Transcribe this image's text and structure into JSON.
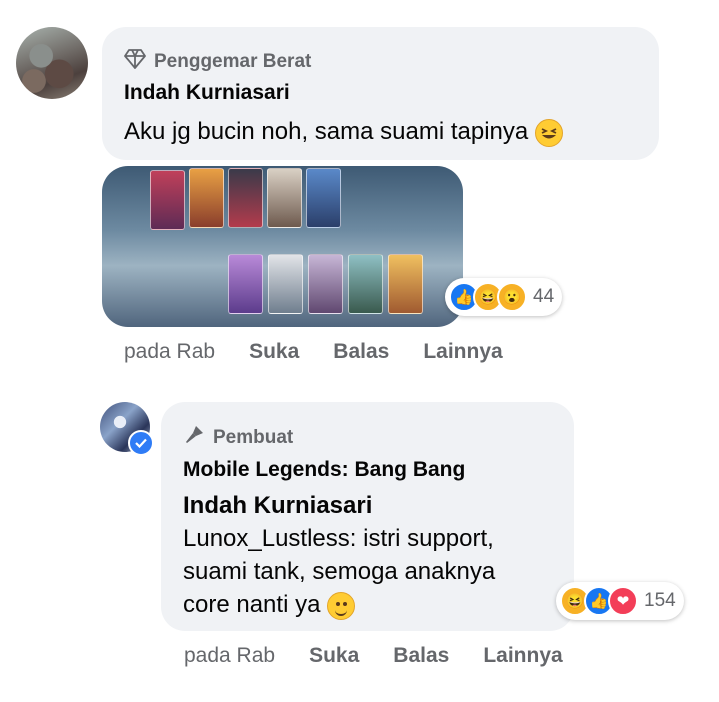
{
  "comments": [
    {
      "badge": "Penggemar Berat",
      "badge_icon": "diamond-icon",
      "author": "Indah Kurniasari",
      "text": "Aku jg bucin noh, sama suami tapinya",
      "emoji": "grinning-squinting-face",
      "attachment": "game-screenshot",
      "reactions": {
        "types": [
          "like",
          "haha",
          "wow"
        ],
        "count": "44"
      },
      "time": "pada Rab",
      "actions": [
        "Suka",
        "Balas",
        "Lainnya"
      ]
    },
    {
      "badge": "Pembuat",
      "badge_icon": "microphone-icon",
      "page": "Mobile Legends: Bang Bang",
      "author": "Indah Kurniasari",
      "text_lines": [
        "Lunox_Lustless: istri support,",
        "suami tank, semoga anaknya",
        "core nanti ya"
      ],
      "emoji": "slightly-smiling-face",
      "verified": true,
      "reactions": {
        "types": [
          "haha",
          "like",
          "love"
        ],
        "count": "154"
      },
      "time": "pada Rab",
      "actions": [
        "Suka",
        "Balas",
        "Lainnya"
      ]
    }
  ],
  "colors": {
    "bubble": "#f0f2f5",
    "secondary_text": "#65676b",
    "like": "#1877f2",
    "love": "#f33e58",
    "haha": "#f7b125"
  }
}
